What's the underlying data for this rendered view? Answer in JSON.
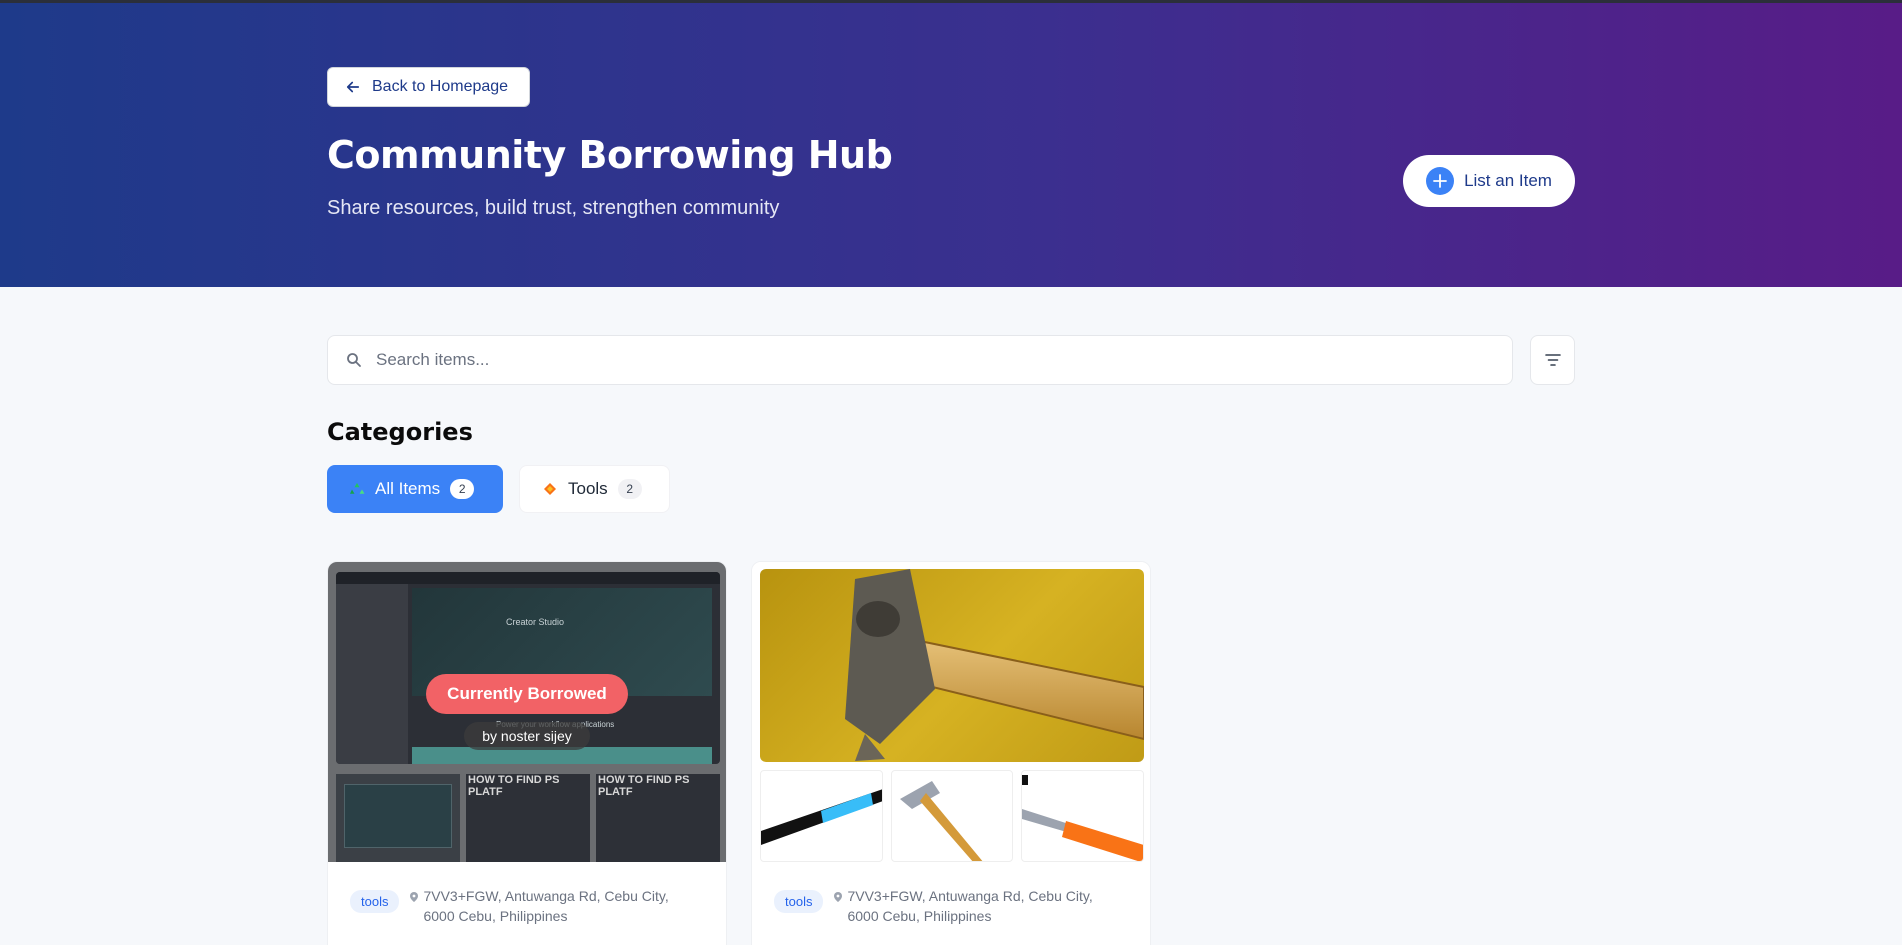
{
  "header": {
    "back_label": "Back to Homepage",
    "title": "Community Borrowing Hub",
    "subtitle": "Share resources, build trust, strengthen community",
    "list_item_label": "List an Item"
  },
  "search": {
    "placeholder": "Search items..."
  },
  "categories": {
    "heading": "Categories",
    "items": [
      {
        "label": "All Items",
        "count": "2",
        "icon": "recycle-icon",
        "active": true
      },
      {
        "label": "Tools",
        "count": "2",
        "icon": "tools-icon",
        "active": false
      }
    ]
  },
  "items": [
    {
      "status": "Currently Borrowed",
      "borrower": "by noster sijey",
      "thumb_text_1": "HOW TO FIND PS PLATF",
      "thumb_text_2": "HOW TO FIND PS PLATF",
      "screenshot_app_title": "Creator Studio",
      "screenshot_tagline": "Power your workflow applications",
      "tag": "tools",
      "location": "7VV3+FGW, Antuwanga Rd, Cebu City, 6000 Cebu, Philippines"
    },
    {
      "tag": "tools",
      "location": "7VV3+FGW, Antuwanga Rd, Cebu City, 6000 Cebu, Philippines"
    }
  ],
  "colors": {
    "accent": "#3b82f6",
    "borrowed": "#f26266",
    "hero_start": "#1e3a8a",
    "hero_end": "#581c87"
  }
}
